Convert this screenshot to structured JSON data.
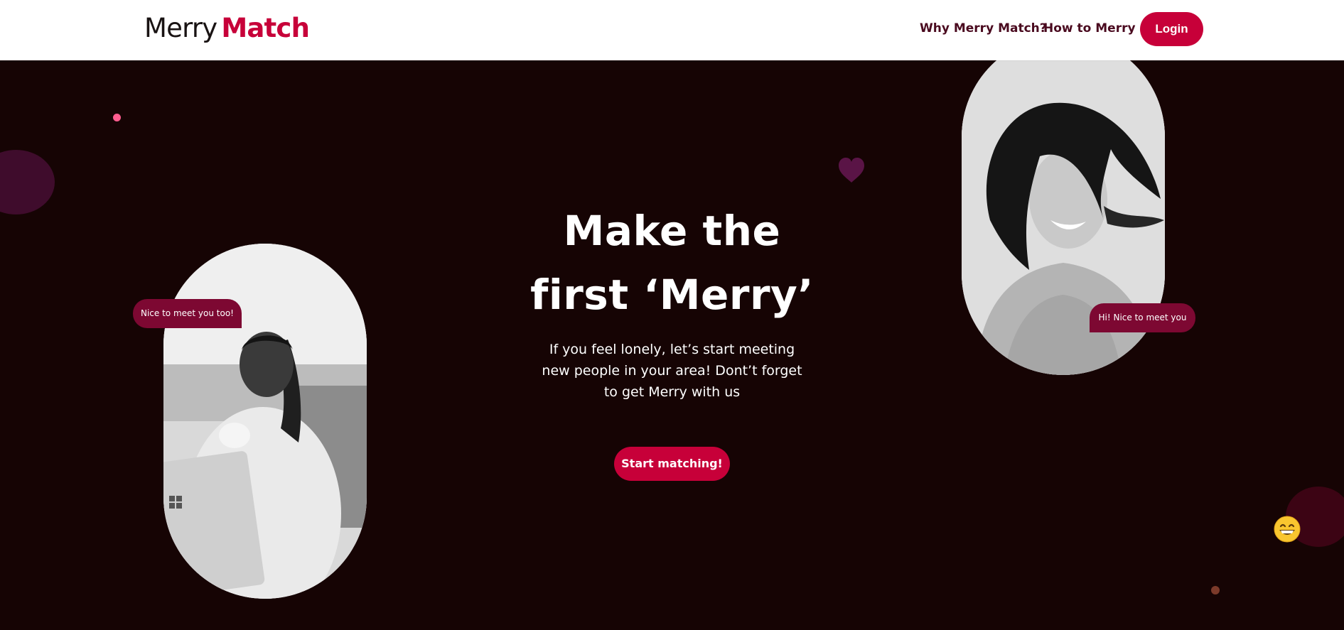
{
  "brand": {
    "name_part1": "Merry",
    "name_part2": "Match",
    "accent_color": "#C70039",
    "dark_color": "#160404"
  },
  "nav": {
    "items": [
      {
        "label": "Why Merry Match?"
      },
      {
        "label": "How to Merry"
      }
    ],
    "login_label": "Login"
  },
  "hero": {
    "title_line1": "Make the",
    "title_line2": "first ‘Merry’",
    "subtitle": "If you feel lonely, let’s start meeting new people in your area! Dont’t forget to get Merry with us",
    "cta_label": "Start matching!",
    "bubble_left": "Nice to meet you too!",
    "bubble_right": "Hi! Nice to meet you"
  },
  "icons": {
    "heart": "heart-icon",
    "emoji": "grinning-face-icon"
  }
}
